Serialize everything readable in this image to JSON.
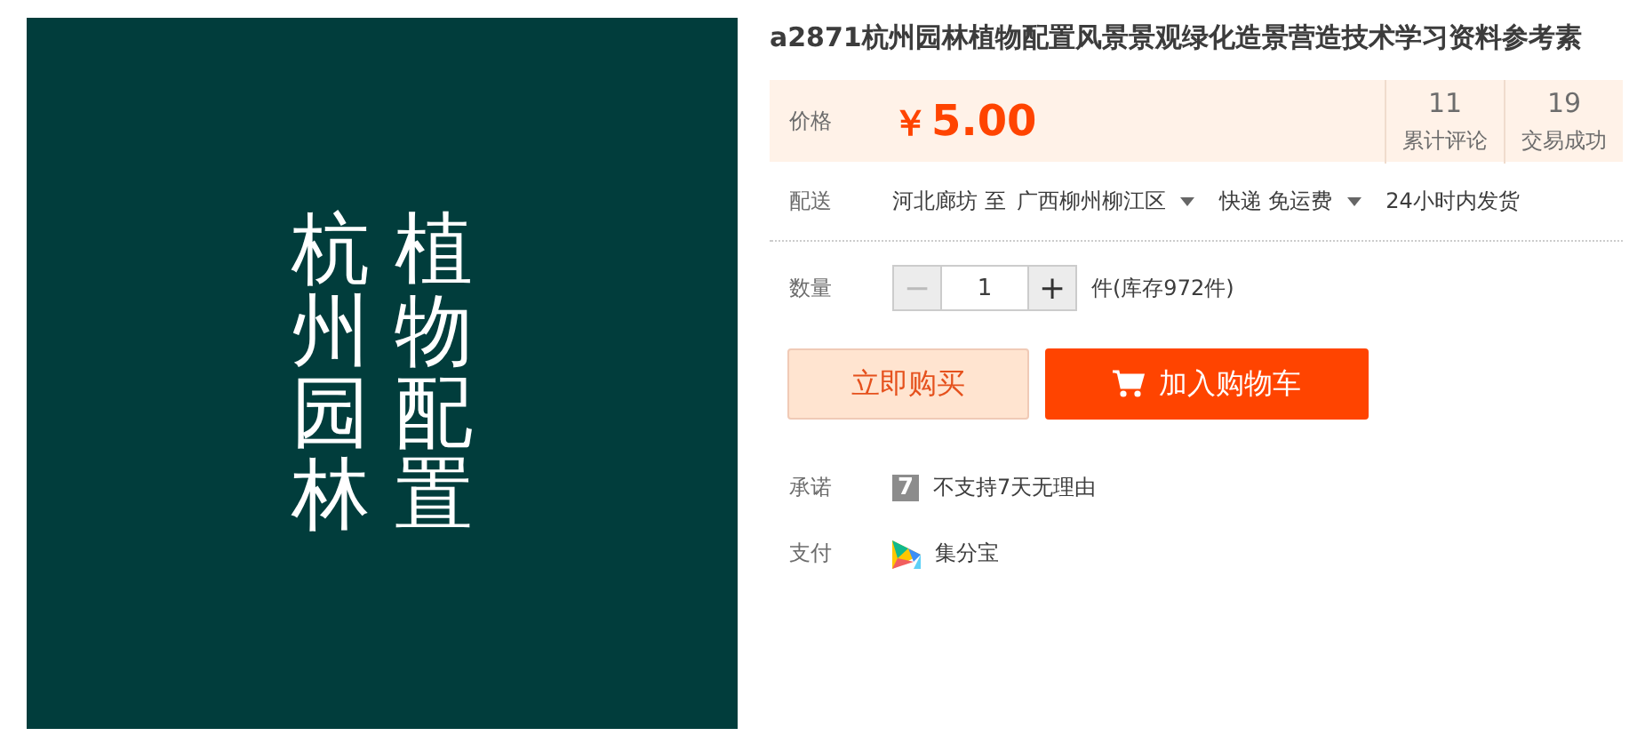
{
  "cover": {
    "columns": [
      "杭州园林",
      "植物配置"
    ]
  },
  "title": "a2871杭州园林植物配置风景景观绿化造景营造技术学习资料参考素",
  "price": {
    "label": "价格",
    "currency": "￥",
    "amount": "5.00",
    "stats": [
      {
        "value": "11",
        "label": "累计评论"
      },
      {
        "value": "19",
        "label": "交易成功"
      }
    ]
  },
  "delivery": {
    "label": "配送",
    "from": "河北廊坊 至",
    "to": "广西柳州柳江区",
    "method": "快递 免运费",
    "time": "24小时内发货"
  },
  "quantity": {
    "label": "数量",
    "minus": "−",
    "value": "1",
    "plus": "+",
    "stock": "件(库存972件)"
  },
  "buttons": [
    {
      "kind": "buy",
      "label": "立即购买"
    },
    {
      "kind": "cart",
      "label": "加入购物车"
    }
  ],
  "services": [
    {
      "kind": "promise",
      "label": "承诺",
      "badge": "7",
      "text": "不支持7天无理由"
    },
    {
      "kind": "payment",
      "label": "支付",
      "text": "集分宝"
    }
  ]
}
